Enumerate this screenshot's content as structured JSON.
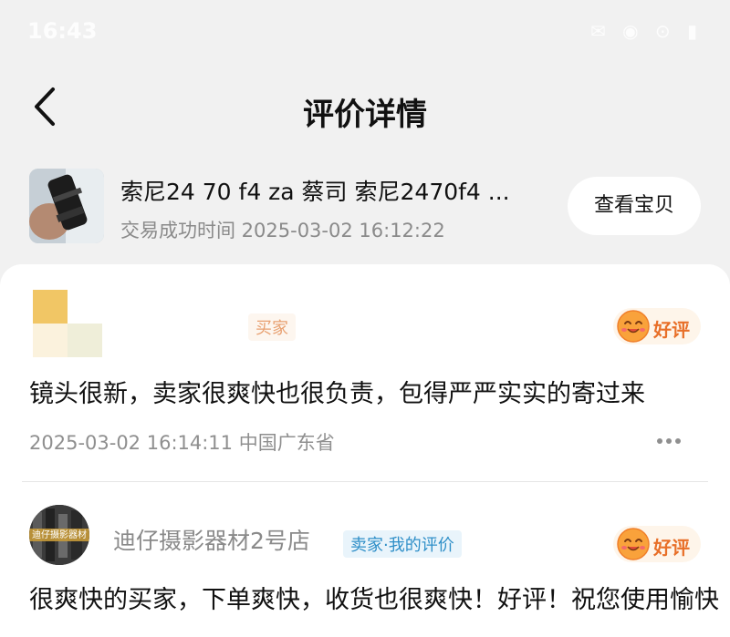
{
  "status_bar": {
    "time": "16:43",
    "icons": "✉ ◉ ⊙ ▮"
  },
  "header": {
    "title": "评价详情",
    "back_icon": "chevron-left-icon"
  },
  "product": {
    "title": "索尼24 70 f4 za 蔡司 索尼2470f4 ...",
    "trade_time": "交易成功时间 2025-03-02 16:12:22",
    "view_button": "查看宝贝"
  },
  "reviews": [
    {
      "role": "买家",
      "rating": "好评",
      "text": "镜头很新，卖家很爽快也很负责，包得严严实实的寄过来",
      "meta": "2025-03-02 16:14:11  中国广东省"
    },
    {
      "avatar_text": "迪仔摄影器材",
      "name": "迪仔摄影器材2号店",
      "role": "卖家·我的评价",
      "rating": "好评",
      "text": "很爽快的买家，下单爽快，收货也很爽快！好评！祝您使用愉快"
    }
  ],
  "colors": {
    "accent": "#e86f28",
    "seller_tag": "#2f8fc8",
    "buyer_tag": "#e8a070"
  }
}
